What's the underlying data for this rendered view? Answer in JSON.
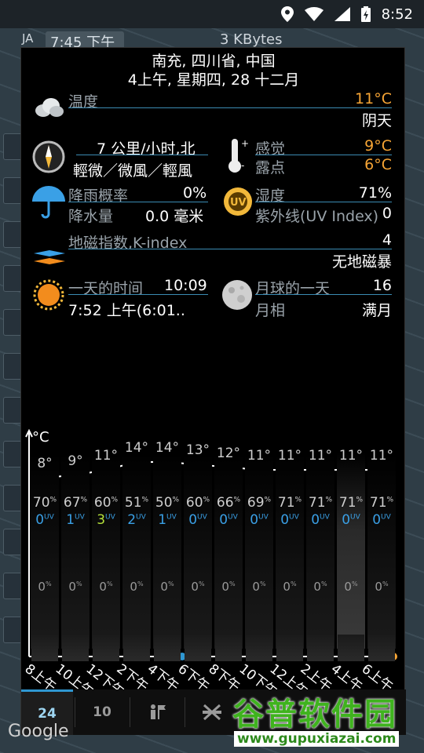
{
  "status_bar": {
    "time": "8:52"
  },
  "map_overlay": {
    "clock": "7:45 下午",
    "data_rate": "3 KBytes",
    "lang": "JA",
    "google": "Google"
  },
  "header": {
    "location": "南充, 四川省, 中国",
    "datetime": "4上午, 星期四, 28 十二月"
  },
  "temperature": {
    "label": "温度",
    "value": "11°C",
    "condition": "阴天"
  },
  "wind": {
    "value": "7 公里/小时,北",
    "description": "輕微／微風／輕風"
  },
  "feels": {
    "label": "感觉",
    "value": "9°C",
    "dew_label": "露点",
    "dew_value": "6°C"
  },
  "rain": {
    "prob_label": "降雨概率",
    "prob_value": "0%",
    "amount_label": "降水量",
    "amount_value": "0.0 毫米"
  },
  "humidity": {
    "label": "湿度",
    "value": "71%",
    "uv_label": "紫外线(UV Index)",
    "uv_value": "0"
  },
  "kindex": {
    "label": "地磁指数,K-index",
    "value": "4",
    "status": "无地磁暴"
  },
  "sun": {
    "label": "一天的时间",
    "value": "10:09",
    "sunrise": "7:52 上午(6:01.."
  },
  "moon": {
    "label": "月球的一天",
    "value": "16",
    "phase_label": "月相",
    "phase_value": "满月"
  },
  "chart_data": {
    "type": "line",
    "unit_label": "°C",
    "x": [
      "8上午",
      "10上午",
      "12下午",
      "2下午",
      "4下午",
      "6下午",
      "8下午",
      "10下午",
      "12上午",
      "2上午",
      "4上午",
      "6上午"
    ],
    "temps": [
      8,
      9,
      11,
      14,
      14,
      13,
      12,
      11,
      11,
      11,
      11,
      11
    ],
    "temp_labels": [
      "8°",
      "9°",
      "11°",
      "14°",
      "14°",
      "13°",
      "12°",
      "11°",
      "11°",
      "11°",
      "11°",
      "11°"
    ],
    "humidity": [
      "70",
      "67",
      "60",
      "51",
      "50",
      "60",
      "66",
      "69",
      "71",
      "71",
      "71",
      "71"
    ],
    "uv": [
      "0",
      "1",
      "3",
      "2",
      "1",
      "0",
      "0",
      "0",
      "0",
      "0",
      "0",
      "0"
    ],
    "precip": [
      "0",
      "0",
      "0",
      "0",
      "0",
      "0",
      "0",
      "0",
      "0",
      "0",
      "0",
      "0"
    ],
    "weather_icons": [
      "sun",
      "sun",
      "sun",
      "sun",
      "sun",
      "sun",
      "moon",
      "moon",
      "moon",
      "cloud",
      "cloud",
      "cloud"
    ],
    "highlight_index": 10,
    "colors": {
      "uv_normal": "#3aa0e6",
      "uv_high": "#b5e23a",
      "line": "#ffffff",
      "accent": "#f7a535"
    }
  },
  "tabs": [
    {
      "label": "24",
      "active": true
    },
    {
      "label": "10",
      "active": false
    }
  ],
  "watermark": {
    "title": "谷普软件园",
    "url": "www.gupuxiazai.com"
  },
  "colors": {
    "accent_orange": "#f7a535",
    "underline_blue": "#3b8bb3",
    "tab_active": "#2f97d1"
  }
}
